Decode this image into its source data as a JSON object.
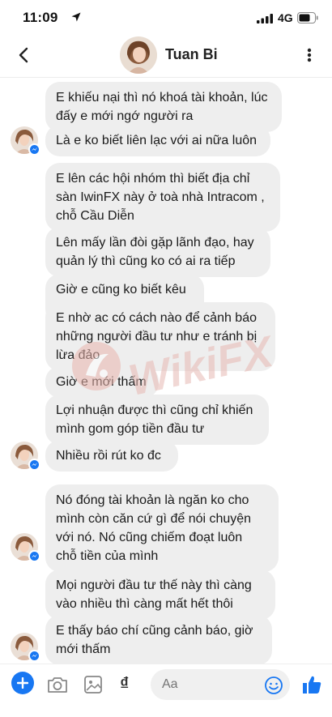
{
  "status": {
    "time": "11:09",
    "network": "4G"
  },
  "header": {
    "contact_name": "Tuan Bi"
  },
  "messages": [
    {
      "text": "E khiếu nại thì nó khoá tài khoản, lúc\nđấy e mới ngớ người ra"
    },
    {
      "text": "Là e ko biết liên lạc với ai nữa luôn"
    },
    {
      "text": "E lên các hội nhóm thì biết địa chỉ\nsàn IwinFX này ở toà nhà Intracom ,\nchỗ Cầu Diễn"
    },
    {
      "text": "Lên mấy lần đòi gặp lãnh đạo, hay\nquản lý thì cũng ko có ai ra tiếp"
    },
    {
      "text": "Giờ e cũng ko biết kêu ai"
    },
    {
      "text": "E nhờ ac có cách nào để cảnh báo\nnhững người đầu tư như e tránh bị\nlừa đảo"
    },
    {
      "text": "Giờ e mới thấm"
    },
    {
      "text": "Lợi nhuận được thì cũng chỉ khiến\nmình gom góp tiền đầu tư"
    },
    {
      "text": "Nhiều rồi rút ko đc"
    },
    {
      "text": "Nó đóng tài khoản là ngăn ko cho\nmình còn căn cứ gì để nói chuyện\nvới nó. Nó cũng chiếm đoạt luôn\nchỗ tiền của mình"
    },
    {
      "text": "Mọi người đầu tư thế này thì càng\nvào nhiều thì càng mất hết thôi"
    },
    {
      "text": "E thấy báo chí cũng cảnh báo, giờ\nmới thấm"
    }
  ],
  "watermark": {
    "text": "WikiFX"
  },
  "composer": {
    "placeholder": "Aa",
    "currency_symbol": "₫"
  },
  "colors": {
    "accent": "#1877f2",
    "bubble": "#eeeeee"
  }
}
